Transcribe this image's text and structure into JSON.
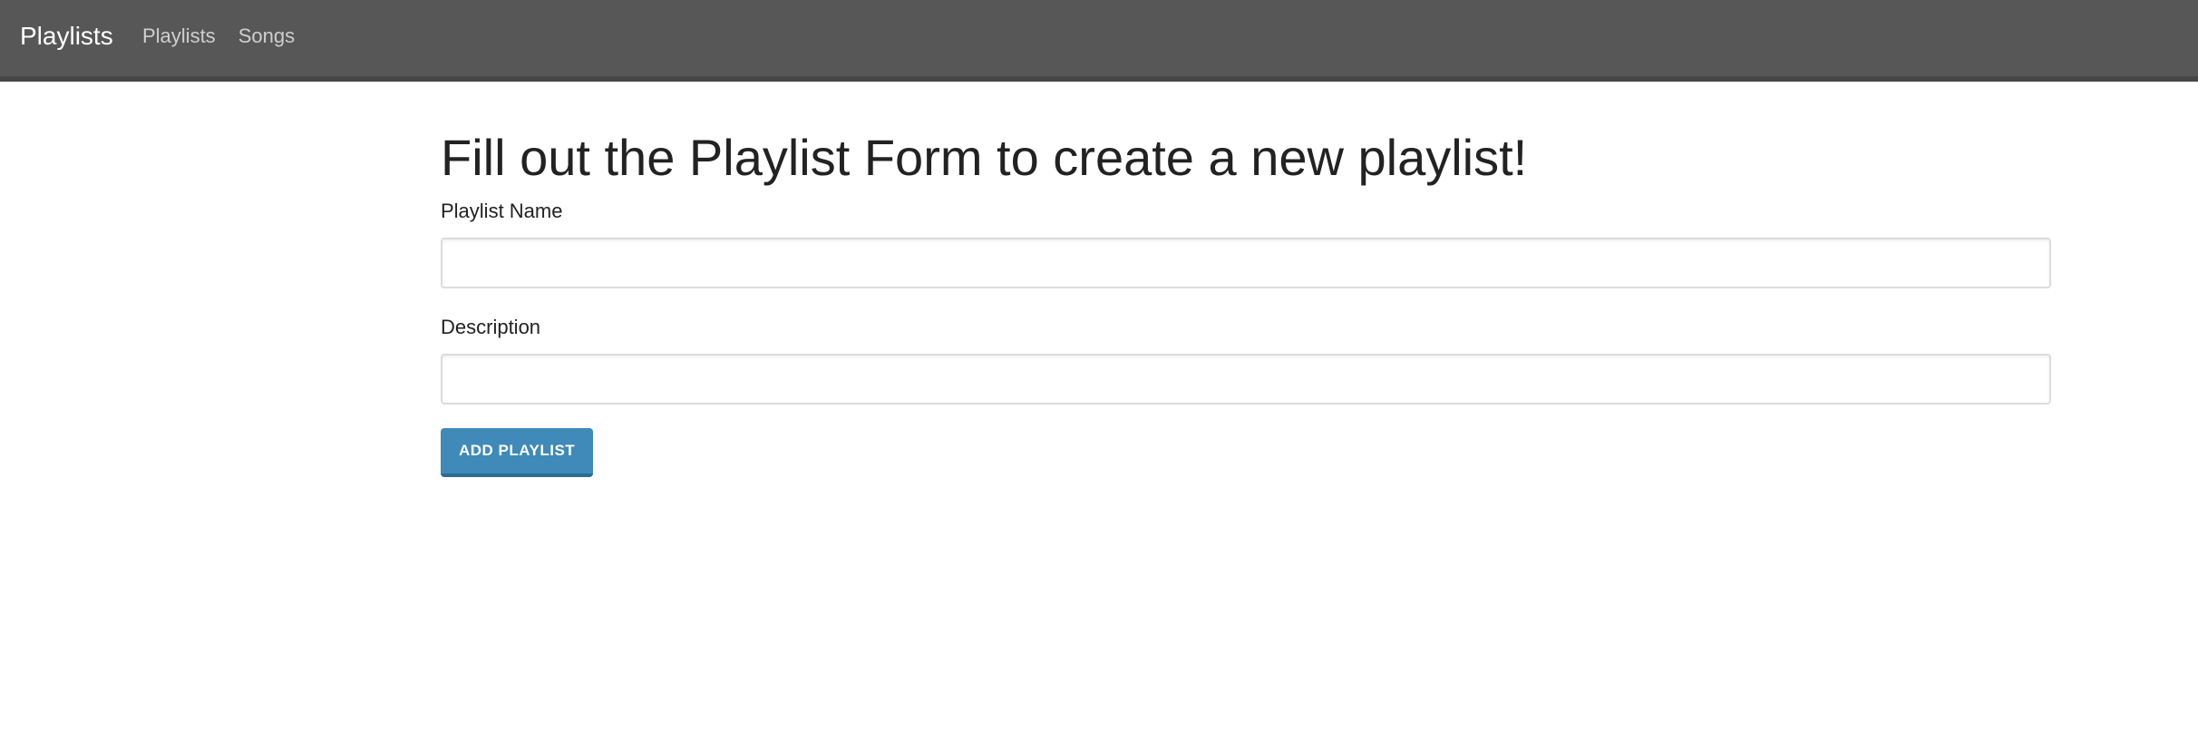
{
  "navbar": {
    "brand": "Playlists",
    "links": [
      {
        "label": "Playlists"
      },
      {
        "label": "Songs"
      }
    ]
  },
  "main": {
    "title": "Fill out the Playlist Form to create a new playlist!",
    "form": {
      "name_label": "Playlist Name",
      "name_value": "",
      "description_label": "Description",
      "description_value": "",
      "submit_label": "ADD PLAYLIST"
    }
  },
  "colors": {
    "navbar_bg": "#575757",
    "button_bg": "#3f8ab9"
  }
}
